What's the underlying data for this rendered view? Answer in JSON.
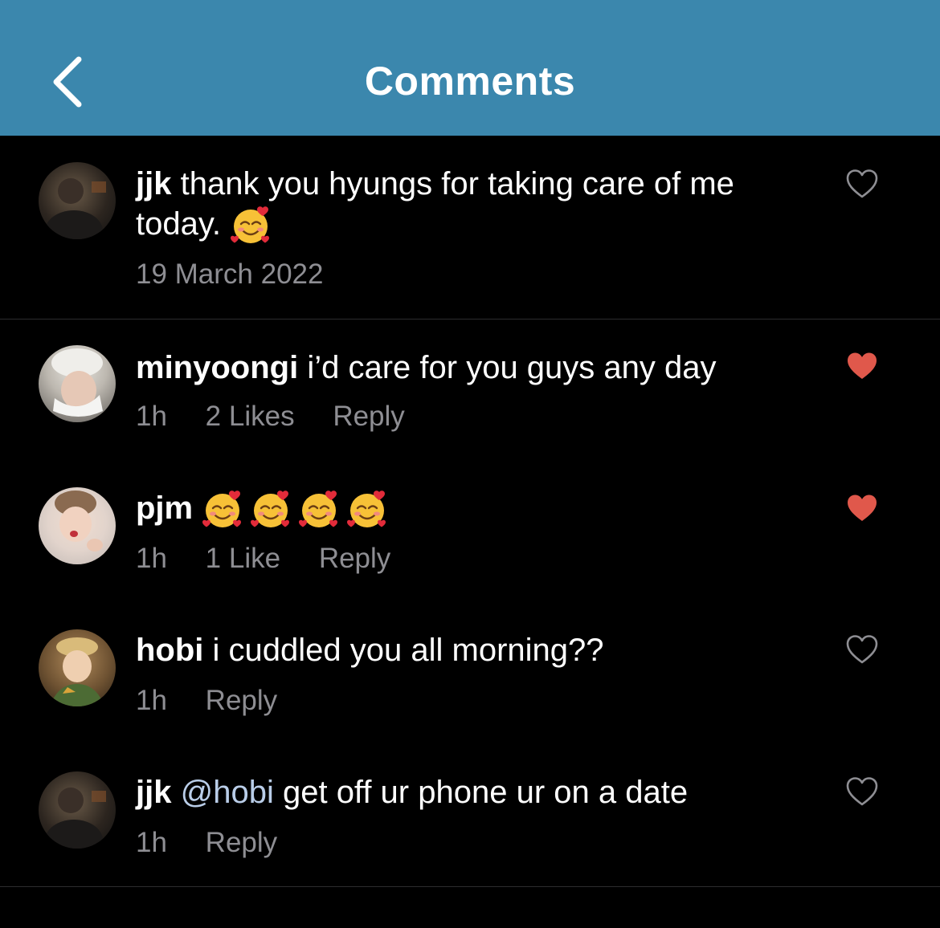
{
  "header": {
    "title": "Comments",
    "back_icon": "chevron-left-icon",
    "color": "#3b87ad"
  },
  "colors": {
    "heart_liked": "#e0584b",
    "meta_text": "#8e8e93",
    "mention": "#b9cde8"
  },
  "comments": [
    {
      "username": "jjk",
      "text": "thank you hyungs for taking care of me today.",
      "emoji": "smiling-face-with-hearts",
      "date": "19 March 2022",
      "liked": false
    },
    {
      "username": "minyoongi",
      "text": "i’d care for you guys any day",
      "time": "1h",
      "likes": "2 Likes",
      "reply": "Reply",
      "liked": true
    },
    {
      "username": "pjm",
      "emoji_count": 4,
      "emoji": "smiling-face-with-hearts",
      "time": "1h",
      "likes": "1 Like",
      "reply": "Reply",
      "liked": true
    },
    {
      "username": "hobi",
      "text": "i cuddled you all morning??",
      "time": "1h",
      "reply": "Reply",
      "liked": false
    },
    {
      "username": "jjk",
      "mention": "@hobi",
      "text": "get off ur phone ur on a date",
      "time": "1h",
      "reply": "Reply",
      "liked": false
    }
  ]
}
